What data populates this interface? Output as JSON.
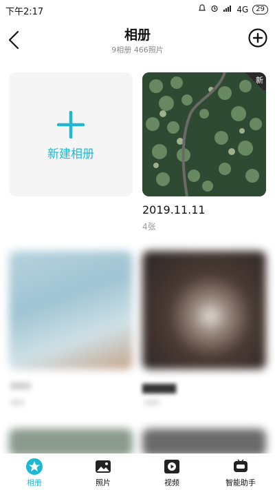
{
  "status": {
    "time": "下午2:17",
    "network": "4G",
    "battery": "29"
  },
  "header": {
    "title": "相册",
    "subtitle": "9相册  466照片"
  },
  "new_album": {
    "label": "新建相册"
  },
  "albums": [
    {
      "name": "2019.11.11",
      "count": "4张",
      "badge": "新"
    }
  ],
  "tabs": [
    {
      "label": "相册",
      "icon": "album-star-icon",
      "active": true
    },
    {
      "label": "照片",
      "icon": "photo-icon",
      "active": false
    },
    {
      "label": "视频",
      "icon": "video-icon",
      "active": false
    },
    {
      "label": "智能助手",
      "icon": "assistant-icon",
      "active": false
    }
  ],
  "colors": {
    "accent": "#1fb8d4"
  }
}
